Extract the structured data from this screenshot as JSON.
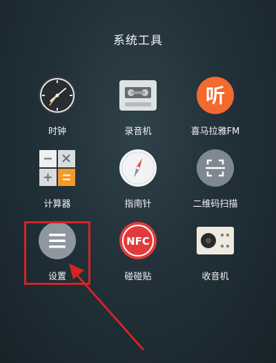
{
  "folder": {
    "title": "系统工具"
  },
  "apps": [
    {
      "label": "时钟",
      "icon": "clock-icon"
    },
    {
      "label": "录音机",
      "icon": "recorder-icon"
    },
    {
      "label": "喜马拉雅FM",
      "icon": "ximalaya-icon",
      "glyph": "听",
      "color": "#f26a2e"
    },
    {
      "label": "计算器",
      "icon": "calculator-icon"
    },
    {
      "label": "指南针",
      "icon": "compass-icon"
    },
    {
      "label": "二维码扫描",
      "icon": "qr-scan-icon"
    },
    {
      "label": "设置",
      "icon": "settings-icon"
    },
    {
      "label": "碰碰贴",
      "icon": "nfc-icon",
      "glyph": "NFC",
      "color": "#e23b3b"
    },
    {
      "label": "收音机",
      "icon": "radio-icon"
    }
  ],
  "annotation": {
    "color": "#d52424"
  }
}
